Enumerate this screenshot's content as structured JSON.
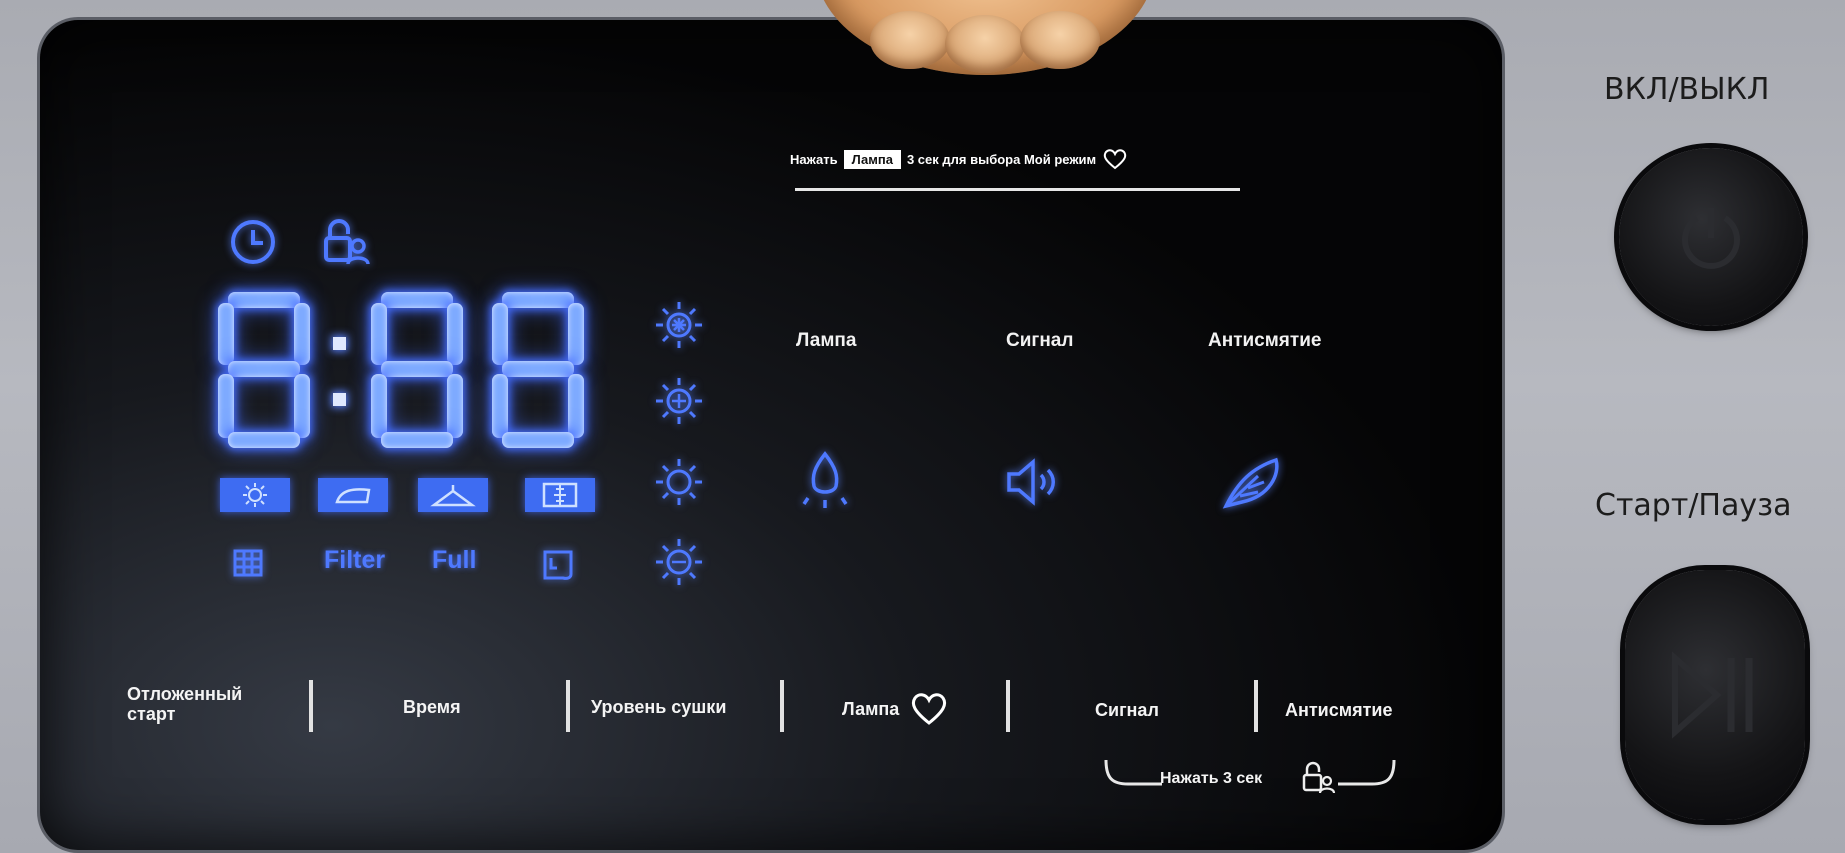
{
  "hint": {
    "prefix": "Нажать",
    "key": "Лампа",
    "suffix": "3 сек для выбора Мой режим"
  },
  "display": {
    "digits": "8:88"
  },
  "mode_labels": {
    "grid": "",
    "filter": "Filter",
    "full": "Full",
    "tank": ""
  },
  "option_labels": {
    "lamp": "Лампа",
    "signal": "Сигнал",
    "anticrease": "Антисмятие"
  },
  "bottom": {
    "delay_line1": "Отложенный",
    "delay_line2": "старт",
    "time": "Время",
    "dry_level": "Уровень сушки",
    "lamp": "Лампа",
    "signal": "Сигнал",
    "anticrease": "Антисмятие",
    "lock_hint": "Нажать 3 сек"
  },
  "side": {
    "power_label": "ВКЛ/ВЫКЛ",
    "start_label": "Старт/Пауза"
  },
  "colors": {
    "accent_blue": "#4e79ff",
    "panel": "#050506",
    "body": "#b0b2b9"
  }
}
